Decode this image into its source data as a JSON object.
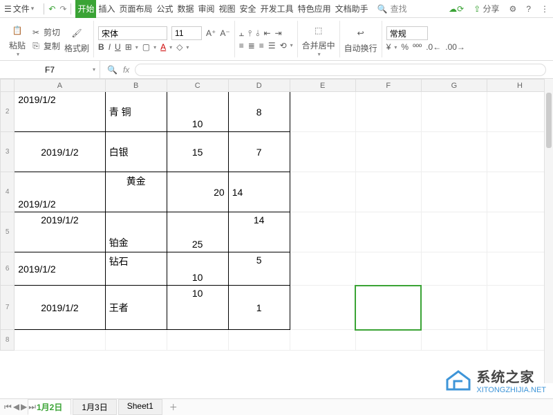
{
  "menu": {
    "file": "文件",
    "tabs": [
      "开始",
      "插入",
      "页面布局",
      "公式",
      "数据",
      "审阅",
      "视图",
      "安全",
      "开发工具",
      "特色应用",
      "文档助手"
    ],
    "active_tab": 0,
    "search": "查找",
    "right": {
      "share": "分享"
    }
  },
  "ribbon": {
    "paste": "粘贴",
    "cut": "剪切",
    "copy": "复制",
    "format_painter": "格式刷",
    "font": "宋体",
    "size": "11",
    "merge": "合并居中",
    "wrap": "自动换行",
    "format": "常规"
  },
  "namebox": "F7",
  "columns": [
    "A",
    "B",
    "C",
    "D",
    "E",
    "F",
    "G",
    "H"
  ],
  "rows": [
    {
      "n": "2",
      "a": "2019/1/2",
      "b": "青       铜",
      "c": "10",
      "d": "8",
      "h": 58,
      "bAlign": "left",
      "aAlign": "left",
      "avAlign": "top",
      "cAlign": "center",
      "cvAlign": "bottom",
      "dAlign": "center"
    },
    {
      "n": "3",
      "a": "2019/1/2",
      "b": "白银",
      "c": "15",
      "d": "7",
      "h": 58,
      "aAlign": "center",
      "bAlign": "left",
      "cAlign": "center",
      "dAlign": "center"
    },
    {
      "n": "4",
      "a": "2019/1/2",
      "b": "黄金",
      "c": "20",
      "d": "14",
      "h": 58,
      "aAlign": "left",
      "avAlign": "bottom",
      "bAlign": "center",
      "bvAlign": "top",
      "cAlign": "right",
      "dAlign": "left"
    },
    {
      "n": "5",
      "a": "2019/1/2",
      "b": "铂金",
      "c": "25",
      "d": "14",
      "h": 58,
      "aAlign": "center",
      "avAlign": "top",
      "bAlign": "left",
      "bvAlign": "bottom",
      "cAlign": "center",
      "cvAlign": "bottom",
      "dAlign": "center",
      "dvAlign": "top"
    },
    {
      "n": "6",
      "a": "2019/1/2",
      "b": "钻石",
      "c": "10",
      "d": "5",
      "h": 48,
      "aAlign": "left",
      "avAlign": "middle",
      "bAlign": "left",
      "bvAlign": "top",
      "cAlign": "center",
      "cvAlign": "bottom",
      "dAlign": "center",
      "dvAlign": "top"
    },
    {
      "n": "7",
      "a": "2019/1/2",
      "b": "王者",
      "c": "10",
      "d": "1",
      "h": 64,
      "aAlign": "center",
      "bAlign": "left",
      "cAlign": "center",
      "cvAlign": "top",
      "dAlign": "center"
    },
    {
      "n": "8",
      "a": "",
      "b": "",
      "c": "",
      "d": "",
      "h": 30
    }
  ],
  "selected": {
    "row": "7",
    "col": "F"
  },
  "sheets": [
    "1月2日",
    "1月3日",
    "Sheet1"
  ],
  "active_sheet": 0,
  "watermark": {
    "title": "系统之家",
    "sub": "XITONGZHIJIA.NET"
  }
}
